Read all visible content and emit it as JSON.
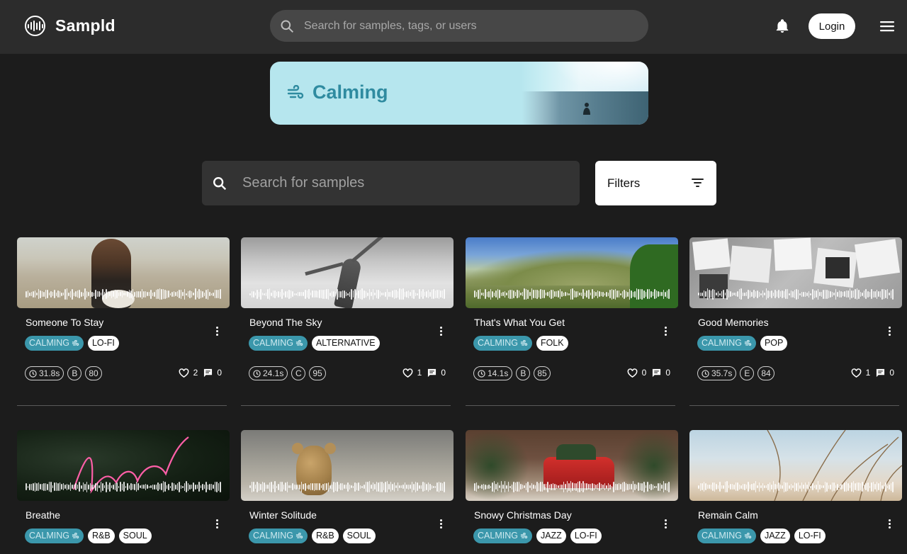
{
  "header": {
    "brand": "Sampld",
    "search_placeholder": "Search for samples, tags, or users",
    "login_label": "Login"
  },
  "banner": {
    "title": "Calming"
  },
  "search": {
    "placeholder": "Search for samples",
    "filters_label": "Filters"
  },
  "colors": {
    "accent": "#3b97ab",
    "banner_bg": "#b6e6ee",
    "banner_text": "#2f8ba0",
    "page_bg": "#1c1c1c",
    "header_bg": "#2c2c2c"
  },
  "samples": [
    {
      "title": "Someone To Stay",
      "tags": [
        "CALMING",
        "LO-FI"
      ],
      "duration": "31.8s",
      "key": "B",
      "bpm": "80",
      "likes": "2",
      "comments": "0"
    },
    {
      "title": "Beyond The Sky",
      "tags": [
        "CALMING",
        "ALTERNATIVE"
      ],
      "duration": "24.1s",
      "key": "C",
      "bpm": "95",
      "likes": "1",
      "comments": "0"
    },
    {
      "title": "That's What You Get",
      "tags": [
        "CALMING",
        "FOLK"
      ],
      "duration": "14.1s",
      "key": "B",
      "bpm": "85",
      "likes": "0",
      "comments": "0"
    },
    {
      "title": "Good Memories",
      "tags": [
        "CALMING",
        "POP"
      ],
      "duration": "35.7s",
      "key": "E",
      "bpm": "84",
      "likes": "1",
      "comments": "0"
    },
    {
      "title": "Breathe",
      "tags": [
        "CALMING",
        "R&B",
        "SOUL"
      ]
    },
    {
      "title": "Winter Solitude",
      "tags": [
        "CALMING",
        "R&B",
        "SOUL"
      ]
    },
    {
      "title": "Snowy Christmas Day",
      "tags": [
        "CALMING",
        "JAZZ",
        "LO-FI"
      ]
    },
    {
      "title": "Remain Calm",
      "tags": [
        "CALMING",
        "JAZZ",
        "LO-FI"
      ]
    }
  ],
  "icons": {
    "logo": "waveform-circle-icon",
    "search": "search-icon",
    "bell": "bell-icon",
    "menu": "hamburger-menu-icon",
    "wind": "wind-icon",
    "filter": "filter-lines-icon",
    "clock": "clock-icon",
    "heart": "heart-icon",
    "comment": "comment-icon",
    "more": "kebab-menu-icon"
  }
}
